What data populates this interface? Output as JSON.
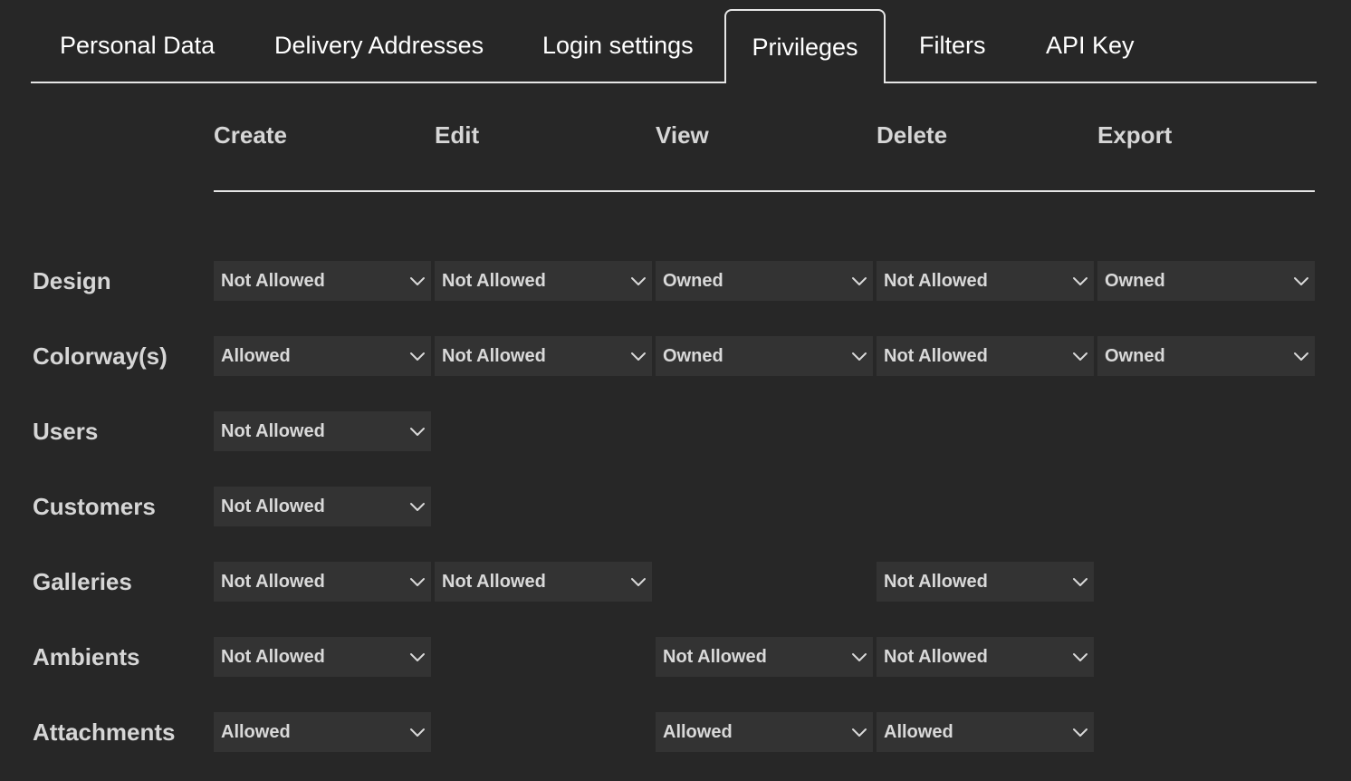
{
  "tabs": [
    {
      "label": "Personal Data",
      "active": false
    },
    {
      "label": "Delivery Addresses",
      "active": false
    },
    {
      "label": "Login settings",
      "active": false
    },
    {
      "label": "Privileges",
      "active": true
    },
    {
      "label": "Filters",
      "active": false
    },
    {
      "label": "API Key",
      "active": false
    }
  ],
  "columns": [
    "Create",
    "Edit",
    "View",
    "Delete",
    "Export"
  ],
  "rows": [
    {
      "label": "Design",
      "values": [
        "Not Allowed",
        "Not Allowed",
        "Owned",
        "Not Allowed",
        "Owned"
      ]
    },
    {
      "label": "Colorway(s)",
      "values": [
        "Allowed",
        "Not Allowed",
        "Owned",
        "Not Allowed",
        "Owned"
      ]
    },
    {
      "label": "Users",
      "values": [
        "Not Allowed",
        null,
        null,
        null,
        null
      ]
    },
    {
      "label": "Customers",
      "values": [
        "Not Allowed",
        null,
        null,
        null,
        null
      ]
    },
    {
      "label": "Galleries",
      "values": [
        "Not Allowed",
        "Not Allowed",
        null,
        "Not Allowed",
        null
      ]
    },
    {
      "label": "Ambients",
      "values": [
        "Not Allowed",
        null,
        "Not Allowed",
        "Not Allowed",
        null
      ]
    },
    {
      "label": "Attachments",
      "values": [
        "Allowed",
        null,
        "Allowed",
        "Allowed",
        null
      ]
    }
  ],
  "icons": {
    "dropdown": "chevron-down-icon"
  },
  "colors": {
    "background": "#272727",
    "select_bg": "#333333",
    "line": "#e6e6e6"
  }
}
